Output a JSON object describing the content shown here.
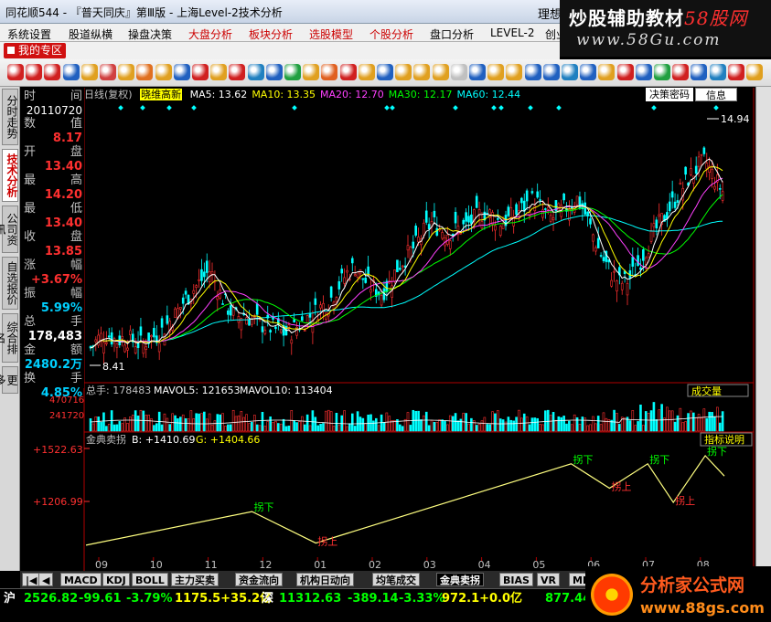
{
  "window": {
    "title": "同花顺544 - 『普天同庆』第Ⅲ版 - 上海Level-2技术分析",
    "right_text": "理想"
  },
  "watermark": {
    "line1_a": "炒股辅助教材",
    "line1_b": "58股网",
    "line2": "www.58Gu.com"
  },
  "menu": [
    "系统设置",
    "股道纵横",
    "操盘决策",
    "大盘分析",
    "板块分析",
    "选股模型",
    "个股分析",
    "盘口分析",
    "LEVEL-2",
    "创业"
  ],
  "menu_red": [
    false,
    false,
    false,
    true,
    true,
    true,
    true,
    false,
    false,
    false
  ],
  "zone_tab": "我的专区",
  "toolbar_icon_colors": [
    "#d02020",
    "#d02020",
    "#d02020",
    "#2060c0",
    "#e0a020",
    "#d04040",
    "#e0a020",
    "#e07020",
    "#e0a020",
    "#2060c0",
    "#d02020",
    "#e0a020",
    "#d02020",
    "#2080c0",
    "#2060c0",
    "#20a040",
    "#e0a020",
    "#e06020",
    "#d02020",
    "#e0a020",
    "#2060c0",
    "#e0a020",
    "#e0a020",
    "#e0a020",
    "#c0c0c0",
    "#2060c0",
    "#e0a020",
    "#e0a020",
    "#2060c0",
    "#2060c0",
    "#2080c0",
    "#2060c0",
    "#e0a020",
    "#d02020",
    "#2060c0",
    "#20a040",
    "#d02020",
    "#2060c0",
    "#2080c0",
    "#d02020",
    "#e0a020"
  ],
  "left_nav": [
    "分时走势",
    "技术分析",
    "公司资讯",
    "自选报价",
    "综合排名",
    "更多"
  ],
  "info_panel": {
    "row1": {
      "label": "时",
      "label2": "间"
    },
    "date": "20110720",
    "rows": [
      {
        "label": "数",
        "label2": "值",
        "value": "8.17",
        "color": "#ff3030"
      },
      {
        "label": "开",
        "label2": "盘",
        "value": "13.40",
        "color": "#ff3030"
      },
      {
        "label": "最",
        "label2": "高",
        "value": "14.20",
        "color": "#ff3030"
      },
      {
        "label": "最",
        "label2": "低",
        "value": "13.40",
        "color": "#ff3030"
      },
      {
        "label": "收",
        "label2": "盘",
        "value": "13.85",
        "color": "#ff3030"
      },
      {
        "label": "涨",
        "label2": "幅",
        "value": "+3.67%",
        "color": "#ff3030"
      },
      {
        "label": "振",
        "label2": "幅",
        "value": "5.99%",
        "color": "#00d0ff"
      },
      {
        "label": "总",
        "label2": "手",
        "value": "178,483",
        "color": "#ffffff"
      },
      {
        "label": "金",
        "label2": "额",
        "value": "2480.2万",
        "color": "#00d0ff"
      },
      {
        "label": "换",
        "label2": "手",
        "value": "4.85%",
        "color": "#00d0ff"
      }
    ]
  },
  "chart_header": {
    "period": "日线(复权)",
    "tag": "晓维高新",
    "ma": [
      {
        "label": "MA5: 13.62",
        "color": "#ffffff"
      },
      {
        "label": "MA10: 13.35",
        "color": "#ffff00"
      },
      {
        "label": "MA20: 12.70",
        "color": "#ff40ff"
      },
      {
        "label": "MA30: 12.17",
        "color": "#00ff00"
      },
      {
        "label": "MA60: 12.44",
        "color": "#00ffff"
      }
    ],
    "btn_decision": "决策密码",
    "btn_info": "信息"
  },
  "volume_header": {
    "total": "总手: 178483",
    "mavol5": "MAVOL5: 121653",
    "mavol10": "MAVOL10: 113404",
    "btn": "成交量"
  },
  "gold_header": {
    "name": "金典卖拐",
    "b": "B: +1410.69",
    "g": "G: +1404.66",
    "btn": "指标说明"
  },
  "bottom_tabs": [
    "MACD",
    "KDJ",
    "BOLL",
    "主力买卖",
    "资金流向",
    "机构日动向",
    "均笔成交",
    "金典卖拐",
    "BIAS",
    "VR",
    "MI"
  ],
  "status": [
    {
      "text": "沪",
      "color": "#ffffff"
    },
    {
      "text": "2526.82",
      "color": "#00ff00"
    },
    {
      "text": "-99.61",
      "color": "#00ff00"
    },
    {
      "text": "-3.79%",
      "color": "#00ff00"
    },
    {
      "text": "1175.5+35.2亿",
      "color": "#ffff00"
    },
    {
      "text": "深",
      "color": "#ffffff"
    },
    {
      "text": "11312.63",
      "color": "#00ff00"
    },
    {
      "text": "-389.14",
      "color": "#00ff00"
    },
    {
      "text": "-3.33%",
      "color": "#00ff00"
    },
    {
      "text": "972.1+0.0亿",
      "color": "#ffff00"
    },
    {
      "text": "877.44",
      "color": "#00ff00"
    }
  ],
  "logo2": {
    "line1": "分析家公式网",
    "line2": "www.88gs.com"
  },
  "chart_data": [
    {
      "type": "candlestick",
      "price_range": [
        8.41,
        14.94
      ],
      "annotations": [
        {
          "text": "14.94",
          "kind": "high"
        },
        {
          "text": "8.41",
          "kind": "low"
        }
      ],
      "right_tick": "41",
      "x_ticks": [
        "09",
        "10",
        "11",
        "12",
        "01",
        "02",
        "03",
        "04",
        "05",
        "06",
        "07",
        "08"
      ],
      "close_path": [
        8.6,
        8.9,
        9.0,
        8.8,
        8.9,
        8.8,
        8.7,
        8.9,
        9.0,
        9.3,
        9.6,
        10.0,
        10.3,
        10.6,
        10.9,
        10.3,
        9.8,
        9.5,
        9.6,
        9.4,
        9.3,
        9.2,
        9.1,
        9.0,
        9.2,
        9.4,
        9.6,
        9.8,
        10.0,
        10.4,
        10.8,
        11.0,
        10.6,
        10.4,
        10.2,
        10.5,
        11.0,
        11.3,
        11.6,
        12.0,
        12.3,
        12.1,
        12.0,
        12.1,
        12.2,
        12.4,
        12.6,
        12.5,
        12.3,
        12.4,
        12.6,
        12.8,
        13.0,
        12.6,
        12.4,
        12.6,
        12.8,
        13.0,
        12.5,
        11.8,
        11.2,
        10.8,
        10.5,
        10.6,
        11.0,
        11.5,
        12.0,
        12.4,
        12.8,
        13.2,
        13.6,
        13.9,
        14.1,
        13.6,
        13.2
      ]
    },
    {
      "type": "volume",
      "y_ticks": [
        "470716",
        "241720"
      ]
    },
    {
      "type": "line",
      "name": "金典卖拐",
      "y_ticks": [
        "+1522.63",
        "+1206.99"
      ],
      "x_ticks": [
        "09",
        "10",
        "11",
        "12",
        "01",
        "02",
        "03",
        "04",
        "05",
        "06",
        "07",
        "08"
      ],
      "x": [
        0,
        0.26,
        0.36,
        0.76,
        0.82,
        0.88,
        0.92,
        0.97,
        1.0
      ],
      "y": [
        1050,
        1215,
        1060,
        1450,
        1330,
        1450,
        1260,
        1490,
        1390
      ],
      "labels": [
        {
          "text": "拐下",
          "at": 1
        },
        {
          "text": "拐上",
          "at": 2
        },
        {
          "text": "拐下",
          "at": 3
        },
        {
          "text": "拐上",
          "at": 4
        },
        {
          "text": "拐下",
          "at": 5
        },
        {
          "text": "拐上",
          "at": 6
        },
        {
          "text": "拐下",
          "at": 7
        }
      ]
    }
  ]
}
